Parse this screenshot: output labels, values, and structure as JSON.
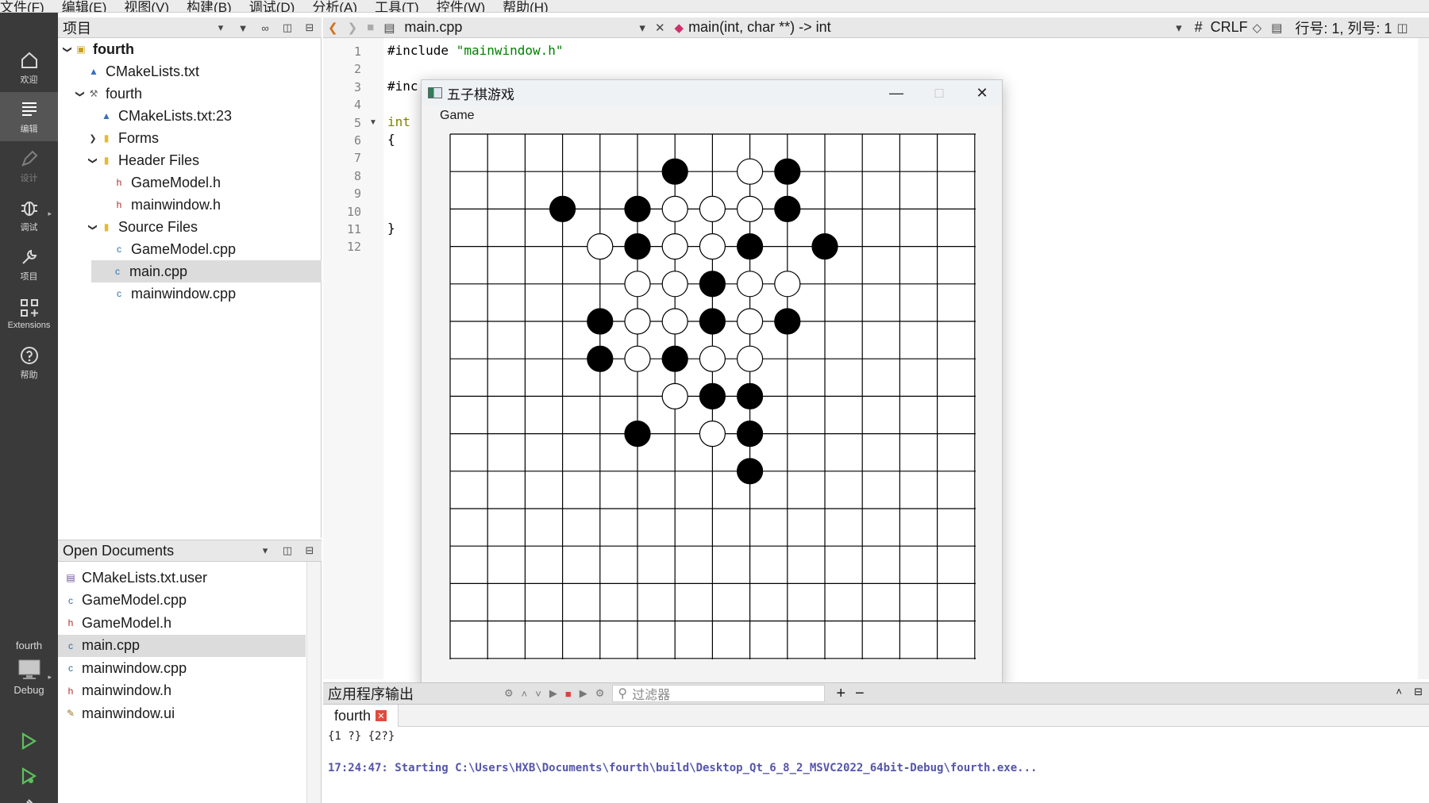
{
  "menu": [
    "文件(F)",
    "编辑(E)",
    "视图(V)",
    "构建(B)",
    "调试(D)",
    "分析(A)",
    "工具(T)",
    "控件(W)",
    "帮助(H)"
  ],
  "modes": [
    {
      "label": "欢迎",
      "icon": "home-icon",
      "active": false
    },
    {
      "label": "编辑",
      "icon": "edit-icon",
      "active": true
    },
    {
      "label": "设计",
      "icon": "design-icon",
      "active": false,
      "disabled": true
    },
    {
      "label": "调试",
      "icon": "bug-icon",
      "active": false
    },
    {
      "label": "项目",
      "icon": "wrench-icon",
      "active": false
    },
    {
      "label": "Extensions",
      "icon": "extensions-icon",
      "active": false
    },
    {
      "label": "帮助",
      "icon": "help-icon",
      "active": false
    }
  ],
  "kit": {
    "project": "fourth",
    "build": "Debug"
  },
  "projects_panel": {
    "title": "项目",
    "tree": [
      {
        "label": "fourth",
        "indent": 0,
        "arrow": "v",
        "icon": "project-icon",
        "bold": true
      },
      {
        "label": "CMakeLists.txt",
        "indent": 1,
        "arrow": "",
        "icon": "cmake-icon"
      },
      {
        "label": "fourth",
        "indent": 1,
        "arrow": "v",
        "icon": "hammer-icon"
      },
      {
        "label": "CMakeLists.txt:23",
        "indent": 2,
        "arrow": "",
        "icon": "cmake-icon"
      },
      {
        "label": "Forms",
        "indent": 2,
        "arrow": ">",
        "icon": "folder-icon"
      },
      {
        "label": "Header Files",
        "indent": 2,
        "arrow": "v",
        "icon": "folder-icon"
      },
      {
        "label": "GameModel.h",
        "indent": 3,
        "arrow": "",
        "icon": "header-file-icon"
      },
      {
        "label": "mainwindow.h",
        "indent": 3,
        "arrow": "",
        "icon": "header-file-icon"
      },
      {
        "label": "Source Files",
        "indent": 2,
        "arrow": "v",
        "icon": "folder-icon"
      },
      {
        "label": "GameModel.cpp",
        "indent": 3,
        "arrow": "",
        "icon": "cpp-file-icon"
      },
      {
        "label": "main.cpp",
        "indent": 3,
        "arrow": "",
        "icon": "cpp-file-icon",
        "selected": true
      },
      {
        "label": "mainwindow.cpp",
        "indent": 3,
        "arrow": "",
        "icon": "cpp-file-icon"
      }
    ]
  },
  "open_documents": {
    "title": "Open Documents",
    "items": [
      {
        "label": "CMakeLists.txt.user",
        "icon": "user-file-icon"
      },
      {
        "label": "GameModel.cpp",
        "icon": "cpp-file-icon"
      },
      {
        "label": "GameModel.h",
        "icon": "header-file-icon"
      },
      {
        "label": "main.cpp",
        "icon": "cpp-file-icon",
        "selected": true
      },
      {
        "label": "mainwindow.cpp",
        "icon": "cpp-file-icon"
      },
      {
        "label": "mainwindow.h",
        "icon": "header-file-icon"
      },
      {
        "label": "mainwindow.ui",
        "icon": "ui-file-icon"
      }
    ]
  },
  "editor": {
    "filename": "main.cpp",
    "symbol": "main(int, char **) -> int",
    "hash": "#",
    "line_ending": "CRLF",
    "position": "行号: 1, 列号: 1",
    "line_numbers": [
      "1",
      "2",
      "3",
      "4",
      "5",
      "6",
      "7",
      "8",
      "9",
      "10",
      "11",
      "12"
    ],
    "lines": [
      {
        "n": 1,
        "parts": [
          {
            "t": "#include ",
            "c": ""
          },
          {
            "t": "\"mainwindow.h\"",
            "c": "str"
          }
        ]
      },
      {
        "n": 3,
        "parts": [
          {
            "t": "#inc",
            "c": ""
          }
        ]
      },
      {
        "n": 5,
        "parts": [
          {
            "t": "int",
            "c": "kw"
          }
        ]
      },
      {
        "n": 6,
        "parts": [
          {
            "t": "{",
            "c": ""
          }
        ]
      },
      {
        "n": 11,
        "parts": [
          {
            "t": "}",
            "c": ""
          }
        ]
      }
    ]
  },
  "game_window": {
    "title": "五子棋游戏",
    "menu": [
      "Game"
    ],
    "board_size": 15,
    "black": [
      [
        6,
        1
      ],
      [
        9,
        1
      ],
      [
        3,
        2
      ],
      [
        5,
        2
      ],
      [
        9,
        2
      ],
      [
        5,
        3
      ],
      [
        8,
        3
      ],
      [
        10,
        3
      ],
      [
        7,
        4
      ],
      [
        4,
        5
      ],
      [
        7,
        5
      ],
      [
        9,
        5
      ],
      [
        4,
        6
      ],
      [
        6,
        6
      ],
      [
        7,
        7
      ],
      [
        8,
        7
      ],
      [
        5,
        8
      ],
      [
        8,
        8
      ],
      [
        8,
        9
      ]
    ],
    "white": [
      [
        8,
        1
      ],
      [
        6,
        2
      ],
      [
        7,
        2
      ],
      [
        8,
        2
      ],
      [
        4,
        3
      ],
      [
        6,
        3
      ],
      [
        7,
        3
      ],
      [
        5,
        4
      ],
      [
        6,
        4
      ],
      [
        8,
        4
      ],
      [
        9,
        4
      ],
      [
        5,
        5
      ],
      [
        6,
        5
      ],
      [
        8,
        5
      ],
      [
        5,
        6
      ],
      [
        7,
        6
      ],
      [
        8,
        6
      ],
      [
        6,
        7
      ],
      [
        7,
        8
      ]
    ]
  },
  "output": {
    "title": "应用程序输出",
    "filter_placeholder": "过滤器",
    "tab": "fourth",
    "lines": [
      "{1 ?} {2?}",
      "17:24:47: Starting C:\\Users\\HXB\\Documents\\fourth\\build\\Desktop_Qt_6_8_2_MSVC2022_64bit-Debug\\fourth.exe..."
    ]
  }
}
